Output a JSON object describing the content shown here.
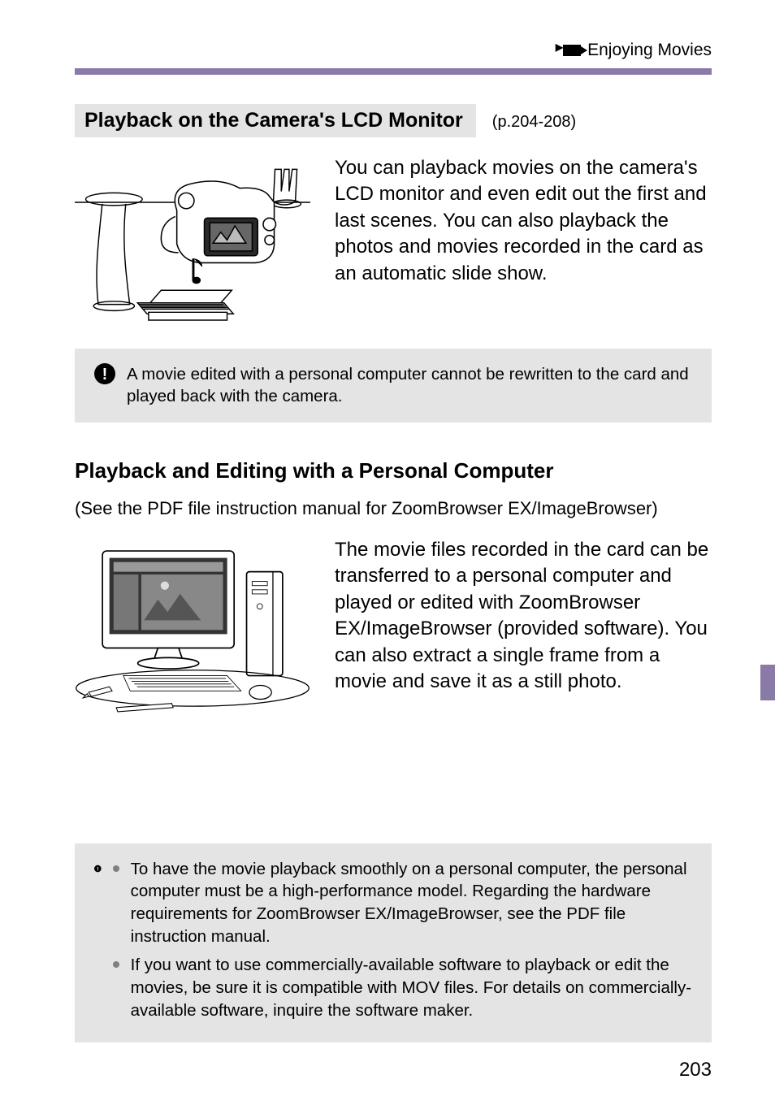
{
  "header": {
    "running": "Enjoying Movies"
  },
  "section1": {
    "title": "Playback on the Camera's LCD Monitor",
    "pageref": "(p.204-208)",
    "body": "You can playback movies on the camera's LCD monitor and even edit out the first and last scenes. You can also playback the photos and movies recorded in the card as an automatic slide show.",
    "note": "A movie edited with a personal computer cannot be rewritten to the card and played back with the camera."
  },
  "section2": {
    "title": "Playback and Editing with a Personal Computer",
    "subtitle": "(See the PDF file instruction manual for ZoomBrowser EX/ImageBrowser)",
    "body": "The movie files recorded in the card can be transferred to a personal computer and played or edited with ZoomBrowser EX/ImageBrowser (provided software). You can also extract a single frame from a movie and save it as a still photo."
  },
  "bottom_notes": {
    "items": [
      "To have the movie playback smoothly on a personal computer, the personal computer must be a high-performance model. Regarding the hardware requirements for ZoomBrowser EX/ImageBrowser, see the PDF file instruction manual.",
      "If you want to use commercially-available software to playback or edit the movies, be sure it is compatible with MOV files. For details on commercially-available software, inquire the software maker."
    ]
  },
  "page_number": "203"
}
